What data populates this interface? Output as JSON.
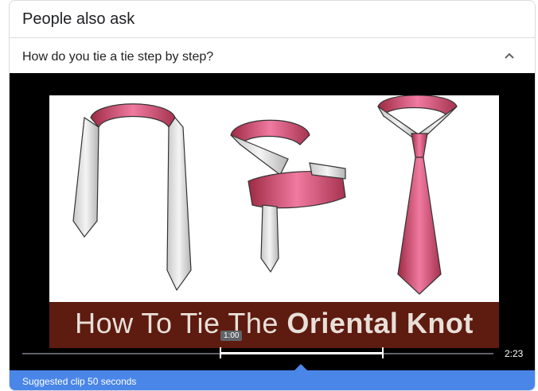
{
  "paa": {
    "title": "People also ask",
    "question": "How do you tie a tie step by step?"
  },
  "video": {
    "banner_text_light": "How To Tie The ",
    "banner_text_bold": "Oriental Knot",
    "marker_time": "1:00",
    "duration": "2:23"
  },
  "suggested_clip": {
    "label": "Suggested clip 50 seconds"
  },
  "colors": {
    "accent": "#4a86e8",
    "tie_pink": "#d9537a",
    "banner_bg": "#5e1b10"
  },
  "icons": {
    "expand": "chevron-up-icon",
    "play": "play-icon"
  }
}
